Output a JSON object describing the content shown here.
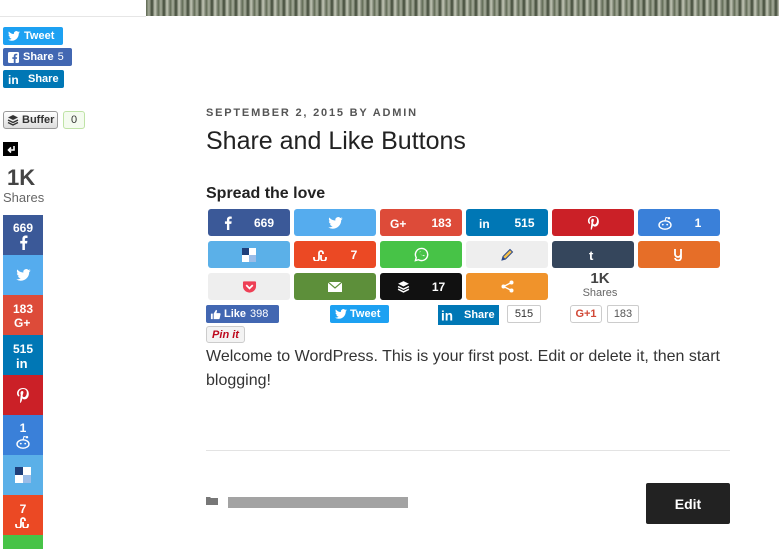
{
  "left_widgets": {
    "tweet": "Tweet",
    "fb_share": "Share",
    "fb_count": "5",
    "li_share": "Share",
    "buffer": "Buffer",
    "buffer_count": "0"
  },
  "side_bar": {
    "total": "1K",
    "label": "Shares",
    "counts": {
      "facebook": "669",
      "googleplus": "183",
      "linkedin": "515",
      "reddit": "1",
      "stumbleupon": "7"
    }
  },
  "post": {
    "meta": "SEPTEMBER 2, 2015 BY ADMIN",
    "title": "Share and Like Buttons",
    "spread": "Spread the love",
    "content": "Welcome to WordPress. This is your first post. Edit or delete it, then start blogging!",
    "edit": "Edit"
  },
  "share_buttons": {
    "facebook": "669",
    "googleplus": "183",
    "linkedin": "515",
    "reddit": "1",
    "stumbleupon": "7",
    "buffer": "17",
    "total": "1K",
    "total_label": "Shares"
  },
  "social_row": {
    "like": "Like",
    "like_count": "398",
    "tweet": "Tweet",
    "li_share": "Share",
    "li_count": "515",
    "gplus": "G+1",
    "gplus_count": "183",
    "pin": "Pin it"
  },
  "colors": {
    "facebook": "#3b5998",
    "twitter": "#55acee",
    "googleplus": "#dd4b39",
    "linkedin": "#0077b5",
    "pinterest": "#cb2027",
    "reddit": "#3a80d9",
    "delicious": "#5bb0e8",
    "stumbleupon": "#eb4924",
    "whatsapp": "#47c347",
    "blogger": "#eeeeee",
    "tumblr": "#35465c",
    "yummly": "#e66e28",
    "pocket": "#eeeeee",
    "email": "#5d8f3a",
    "buffer": "#111111",
    "more": "#f0932b"
  }
}
